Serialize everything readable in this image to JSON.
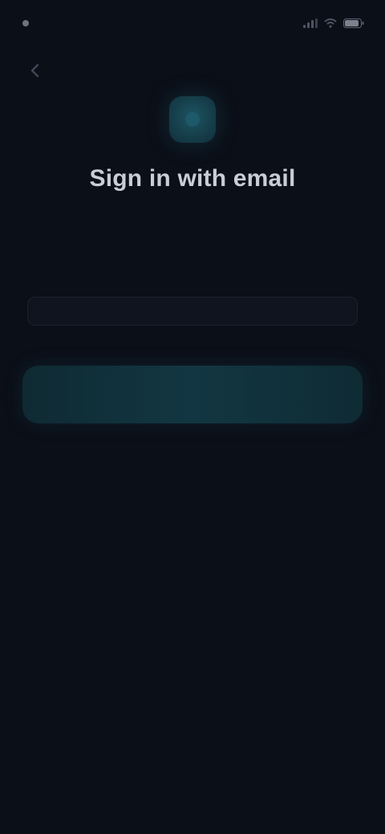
{
  "status_bar": {
    "time": "",
    "icons": [
      "signal-icon",
      "wifi-icon",
      "battery-icon"
    ]
  },
  "back_button": {
    "icon": "arrow-left-icon"
  },
  "brand": {
    "icon": "app-logo-icon",
    "color": "#1d5563"
  },
  "title": "Sign in with email",
  "subtitle": "",
  "email": {
    "label": "",
    "value": "",
    "placeholder": ""
  },
  "primary_button": {
    "label": ""
  },
  "colors": {
    "background": "#0b0f18",
    "accent": "#163f4b",
    "button": "#123742"
  }
}
